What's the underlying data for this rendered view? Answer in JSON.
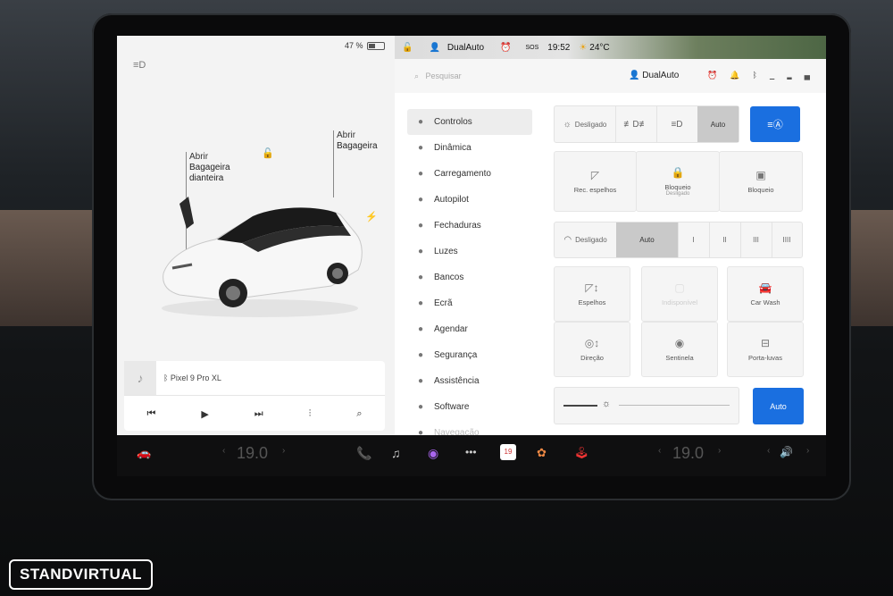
{
  "left_panel": {
    "battery_text": "47 %",
    "battery_level": 0.47,
    "front_trunk_label": [
      "Abrir",
      "Bagageira",
      "dianteira"
    ],
    "rear_trunk_label": [
      "Abrir",
      "Bagageira"
    ]
  },
  "media": {
    "device": "Pixel 9 Pro XL",
    "icons": [
      "music-note-icon",
      "bluetooth-icon",
      "previous-icon",
      "play-icon",
      "next-icon",
      "equalizer-icon",
      "search-icon"
    ]
  },
  "status_bar": {
    "profile": "DualAuto",
    "time": "19:52",
    "temperature": "24°C",
    "sos": "SOS"
  },
  "search": {
    "placeholder": "Pesquisar",
    "profile_name": "DualAuto"
  },
  "nav": [
    {
      "label": "Controlos",
      "icon": "toggle-icon",
      "active": true
    },
    {
      "label": "Dinâmica",
      "icon": "car-icon"
    },
    {
      "label": "Carregamento",
      "icon": "bolt-icon"
    },
    {
      "label": "Autopilot",
      "icon": "steering-wheel-icon"
    },
    {
      "label": "Fechaduras",
      "icon": "lock-icon"
    },
    {
      "label": "Luzes",
      "icon": "sun-icon"
    },
    {
      "label": "Bancos",
      "icon": "seat-icon"
    },
    {
      "label": "Ecrã",
      "icon": "display-icon"
    },
    {
      "label": "Agendar",
      "icon": "clock-icon"
    },
    {
      "label": "Segurança",
      "icon": "info-icon"
    },
    {
      "label": "Assistência",
      "icon": "wrench-icon"
    },
    {
      "label": "Software",
      "icon": "download-icon"
    },
    {
      "label": "Navegação",
      "icon": "navigation-icon"
    }
  ],
  "lights": {
    "off_label": "Desligado",
    "auto_label": "Auto"
  },
  "mirrors_row": {
    "fold_mirrors": "Rec. espelhos",
    "child_lock": "Bloqueio",
    "child_lock_sub": "Desligado",
    "window_lock": "Bloqueio"
  },
  "wipers": {
    "off_label": "Desligado",
    "auto_label": "Auto",
    "speeds": [
      "I",
      "II",
      "III",
      "IIII"
    ]
  },
  "tiles": {
    "mirrors": "Espelhos",
    "unavailable": "Indisponível",
    "car_wash": "Car Wash",
    "steering": "Direção",
    "sentry": "Sentinela",
    "glovebox": "Porta-luvas"
  },
  "brightness": {
    "auto_label": "Auto",
    "level": 0.2
  },
  "bottom_bar": {
    "left_temp": "19.0",
    "right_temp": "19.0",
    "calendar_day": "19"
  },
  "watermark": "STANDVIRTUAL"
}
